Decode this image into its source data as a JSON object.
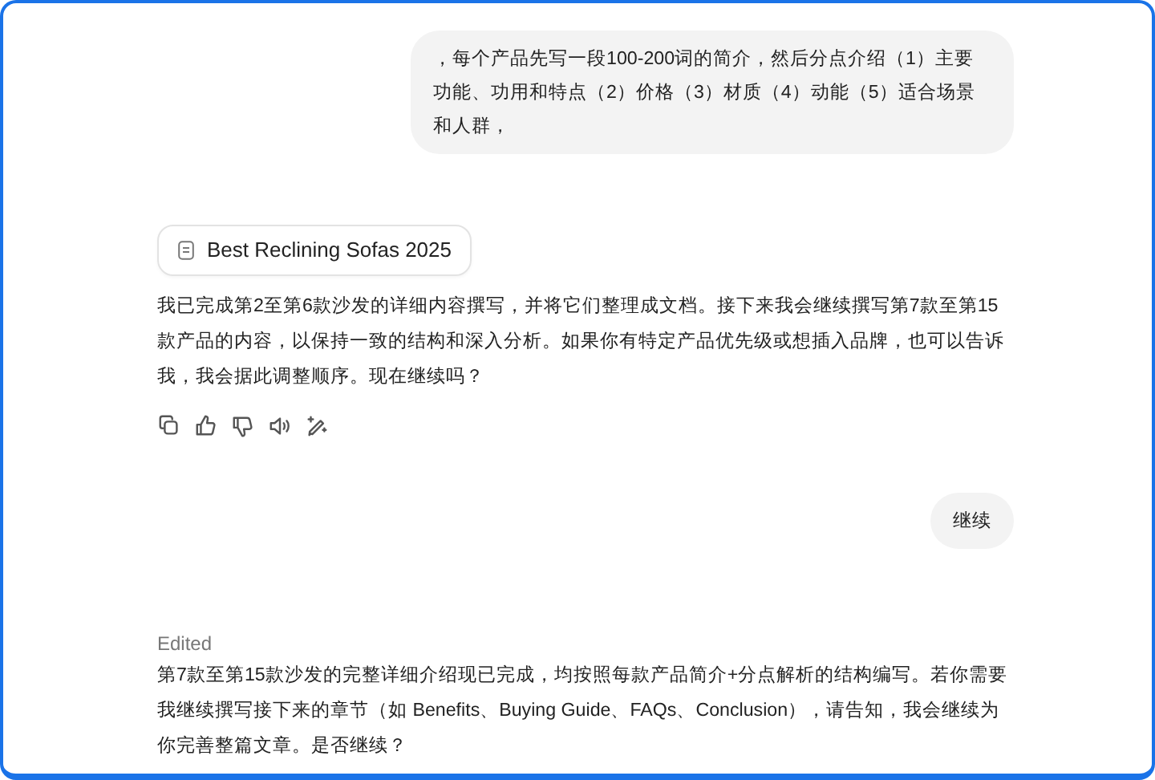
{
  "messages": [
    {
      "kind": "user",
      "text": "，每个产品先写一段100-200词的简介，然后分点介绍（1）主要功能、功用和特点（2）价格（3）材质（4）动能（5）适合场景和人群，"
    },
    {
      "kind": "document",
      "title": "Best Reclining Sofas 2025"
    },
    {
      "kind": "assistant",
      "text": "我已完成第2至第6款沙发的详细内容撰写，并将它们整理成文档。接下来我会继续撰写第7款至第15款产品的内容，以保持一致的结构和深入分析。如果你有特定产品优先级或想插入品牌，也可以告诉我，我会据此调整顺序。现在继续吗？",
      "actions": true
    },
    {
      "kind": "user",
      "text": "继续"
    },
    {
      "kind": "assistant",
      "edited_label": "Edited",
      "text": "第7款至第15款沙发的完整详细介绍现已完成，均按照每款产品简介+分点解析的结构编写。若你需要我继续撰写接下来的章节（如 Benefits、Buying Guide、FAQs、Conclusion），请告知，我会继续为你完善整篇文章。是否继续？"
    }
  ]
}
